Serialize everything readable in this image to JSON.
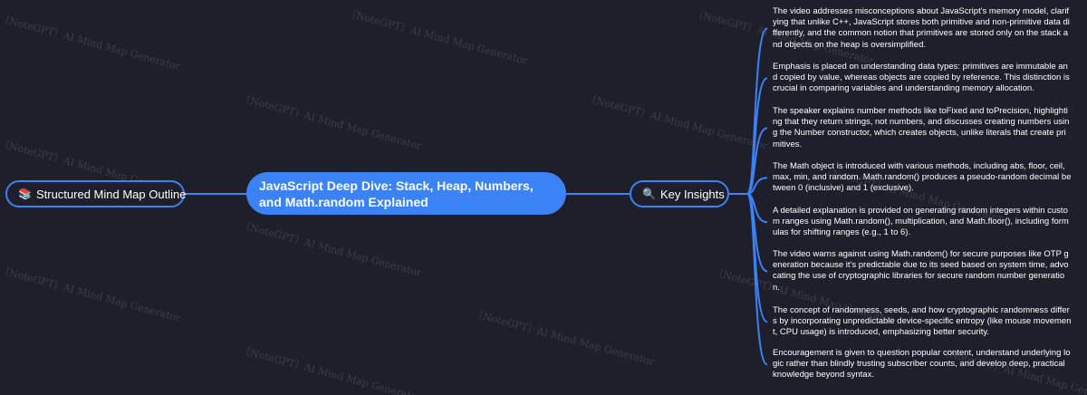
{
  "watermark": "〔NoteGPT〕AI Mind Map Generator",
  "left_node": {
    "icon": "📚",
    "label": "Structured Mind Map Outline"
  },
  "root_node": {
    "label": "JavaScript Deep Dive: Stack, Heap, Numbers, and Math.random Explained"
  },
  "insight_node": {
    "icon": "🔍",
    "label": "Key Insights"
  },
  "insights": [
    "The video addresses misconceptions about JavaScript's memory model, clarifying that unlike C++, JavaScript stores both primitive and non-primitive data differently, and the common notion that primitives are stored only on the stack and objects on the heap is oversimplified.",
    "Emphasis is placed on understanding data types: primitives are immutable and copied by value, whereas objects are copied by reference. This distinction is crucial in comparing variables and understanding memory allocation.",
    "The speaker explains number methods like toFixed and toPrecision, highlighting that they return strings, not numbers, and discusses creating numbers using the Number constructor, which creates objects, unlike literals that create primitives.",
    "The Math object is introduced with various methods, including abs, floor, ceil, max, min, and random. Math.random() produces a pseudo-random decimal between 0 (inclusive) and 1 (exclusive).",
    "A detailed explanation is provided on generating random integers within custom ranges using Math.random(), multiplication, and Math.floor(), including formulas for shifting ranges (e.g., 1 to 6).",
    "The video warns against using Math.random() for secure purposes like OTP generation because it's predictable due to its seed based on system time, advocating the use of cryptographic libraries for secure random number generation.",
    "The concept of randomness, seeds, and how cryptographic randomness differs by incorporating unpredictable device-specific entropy (like mouse movement, CPU usage) is introduced, emphasizing better security.",
    "Encouragement is given to question popular content, understand underlying logic rather than blindly trusting subscriber counts, and develop deep, practical knowledge beyond syntax."
  ],
  "colors": {
    "background": "#1e1f2a",
    "accent": "#3b82f6",
    "text": "#ffffff"
  }
}
